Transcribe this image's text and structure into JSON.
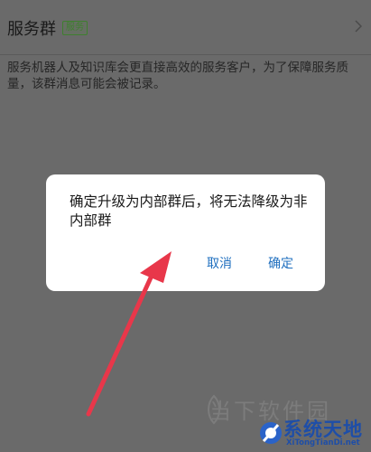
{
  "service_group": {
    "title": "服务群",
    "badge": "服务",
    "description": "服务机器人及知识库会更直接高效的服务客户，为了保障服务质量，该群消息可能会被记录。"
  },
  "dialog": {
    "message": "确定升级为内部群后，将无法降级为非内部群",
    "cancel_label": "取消",
    "confirm_label": "确定"
  },
  "watermarks": {
    "secondary": "当下软件园",
    "brand_title": "系统天地",
    "brand_url": "XiTongTianDi.net"
  },
  "colors": {
    "overlay": "#6a6a6a",
    "dialog_button": "#1f6fbf",
    "arrow": "#e8374a",
    "brand_blue": "#1e4ea8"
  }
}
